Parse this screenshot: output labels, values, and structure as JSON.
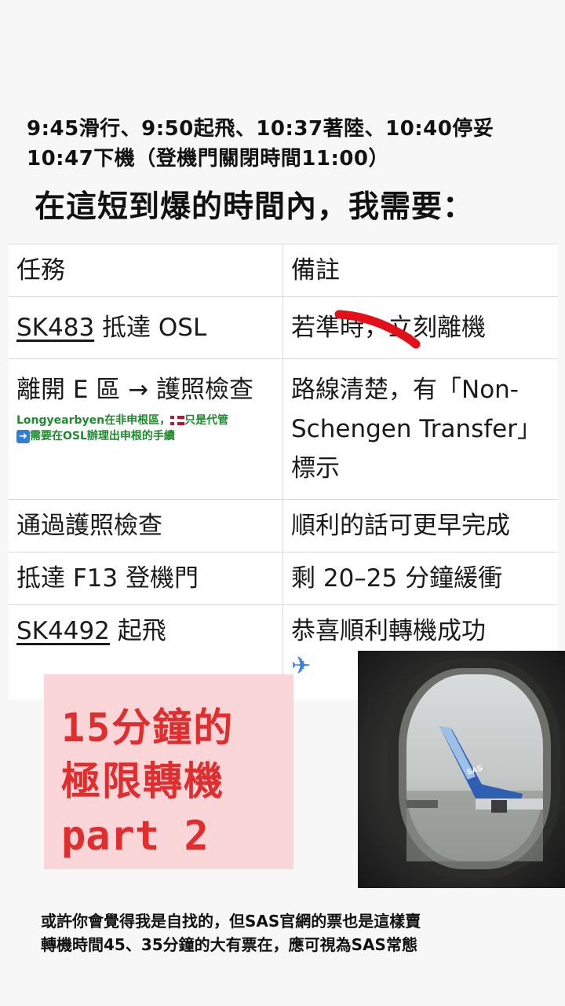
{
  "times": {
    "line1": "9:45滑行、9:50起飛、10:37著陸、10:40停妥",
    "line2": "10:47下機（登機門關閉時間11:00）"
  },
  "headline": "在這短到爆的時間內，我需要：",
  "table": {
    "headers": [
      "任務",
      "備註"
    ],
    "rows": [
      {
        "task": "SK483 抵達 OSL",
        "task_link": "SK483",
        "task_rest": " 抵達 OSL",
        "note": "若準時，立刻離機",
        "note_struck": "準時",
        "note_prefix": "若",
        "note_suffix": "，立刻離機"
      },
      {
        "task": "離開 E 區 → 護照檢查",
        "note": "路線清楚，有「Non-Schengen Transfer」標示"
      },
      {
        "task": "通過護照檢查",
        "note": "順利的話可更早完成"
      },
      {
        "task": "抵達 F13 登機門",
        "note": "剩 20–25 分鐘緩衝"
      },
      {
        "task": "SK4492 起飛",
        "task_link": "SK4492",
        "task_rest": " 起飛",
        "note": "恭喜順利轉機成功",
        "note_emoji": "✈️"
      }
    ],
    "green_note": {
      "line1": "Longyearbyen在非申根區，",
      "line1b": "只是代管",
      "line2": "需要在OSL辦理出申根的手續",
      "flag_icon": "norway-flag-icon",
      "arrow_icon": "right-arrow-icon"
    }
  },
  "overlay": {
    "line1": "15分鐘的",
    "line2": "極限轉機",
    "line3": "part 2"
  },
  "footer": {
    "line1": "或許你會覺得我是自找的，但SAS官網的票也是這樣賣",
    "line2": "轉機時間45、35分鐘的大有票在，應可視為SAS常態"
  },
  "colors": {
    "accent_red": "#e02d2d",
    "pink_bg": "#fbd6d9",
    "green_note": "#1e8a2d"
  }
}
